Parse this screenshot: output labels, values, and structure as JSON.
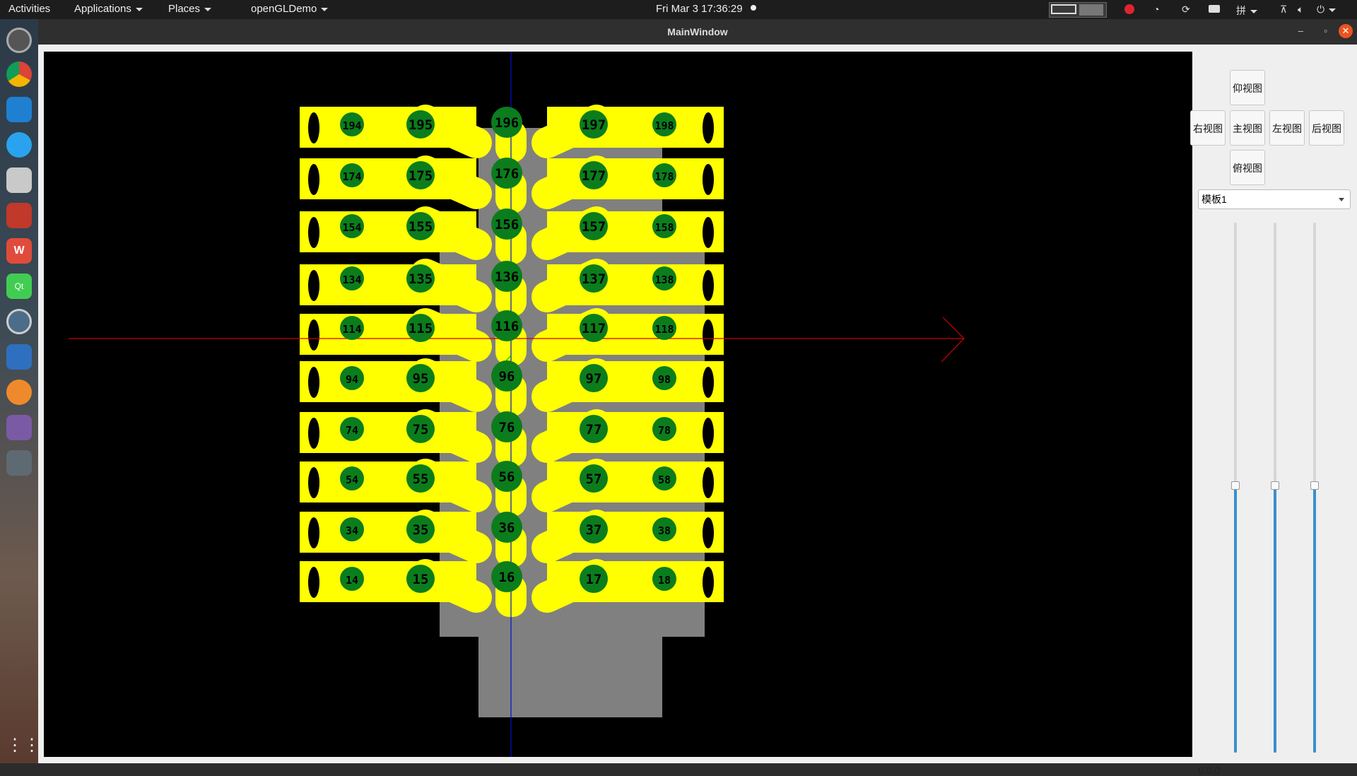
{
  "topbar": {
    "activities": "Activities",
    "applications": "Applications",
    "places": "Places",
    "app_menu": "openGLDemo",
    "clock": "Fri Mar 3  17:36:29",
    "input_method": "拼"
  },
  "dock": {
    "icons": [
      "settings-icon",
      "chrome-icon",
      "vscode-icon",
      "feishu-icon",
      "files-icon",
      "terminal-icon",
      "wps-icon",
      "qt-creator-icon",
      "camera-icon",
      "thunderbird-icon",
      "sublime-icon",
      "screenshot-icon",
      "blank-icon",
      "show-apps-icon"
    ]
  },
  "window": {
    "title": "MainWindow"
  },
  "viewport": {
    "axis_colors": {
      "x": "#d00000",
      "y": "#0010c8",
      "z": "#00c800"
    },
    "cylinder_color": "#808080",
    "pin_color": "#ffff00",
    "label_fill": "#0b7d1d",
    "center_labels": [
      "196",
      "176",
      "156",
      "136",
      "116",
      "96",
      "76",
      "56",
      "36",
      "16"
    ],
    "left_inner_labels": [
      "195",
      "175",
      "155",
      "135",
      "115",
      "95",
      "75",
      "55",
      "35",
      "15"
    ],
    "right_inner_labels": [
      "197",
      "177",
      "157",
      "137",
      "117",
      "97",
      "77",
      "57",
      "37",
      "17"
    ],
    "left_outer_labels": [
      "194",
      "174",
      "154",
      "134",
      "114",
      "94",
      "74",
      "54",
      "34",
      "14"
    ],
    "right_outer_labels": [
      "198",
      "178",
      "158",
      "138",
      "118",
      "98",
      "78",
      "58",
      "38",
      "18"
    ]
  },
  "side_panel": {
    "view_bottom": "仰视图",
    "view_right": "右视图",
    "view_front": "主视图",
    "view_left": "左视图",
    "view_back": "后视图",
    "view_top": "俯视图",
    "template_select": "模板1",
    "slider_values": [
      50,
      50,
      50
    ],
    "coords": "0,0,0"
  }
}
